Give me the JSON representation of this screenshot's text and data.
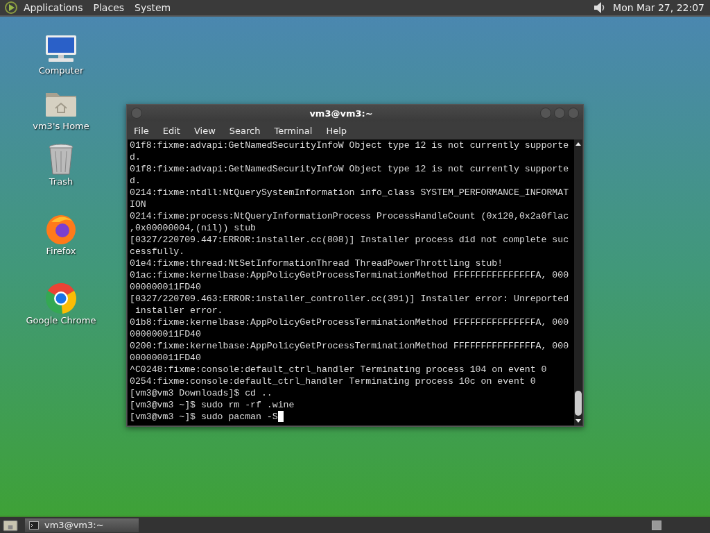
{
  "top_panel": {
    "menus": [
      "Applications",
      "Places",
      "System"
    ],
    "clock": "Mon Mar 27, 22:07"
  },
  "desktop_icons": [
    {
      "kind": "computer",
      "label": "Computer"
    },
    {
      "kind": "home",
      "label": "vm3's Home"
    },
    {
      "kind": "trash",
      "label": "Trash"
    },
    {
      "kind": "firefox",
      "label": "Firefox"
    },
    {
      "kind": "chrome",
      "label": "Google Chrome"
    }
  ],
  "window": {
    "title": "vm3@vm3:~",
    "menu": [
      "File",
      "Edit",
      "View",
      "Search",
      "Terminal",
      "Help"
    ],
    "lines": [
      "01f8:fixme:advapi:GetNamedSecurityInfoW Object type 12 is not currently supporte",
      "d.",
      "01f8:fixme:advapi:GetNamedSecurityInfoW Object type 12 is not currently supporte",
      "d.",
      "0214:fixme:ntdll:NtQuerySystemInformation info_class SYSTEM_PERFORMANCE_INFORMAT",
      "ION",
      "0214:fixme:process:NtQueryInformationProcess ProcessHandleCount (0x120,0x2a0flac",
      ",0x00000004,(nil)) stub",
      "[0327/220709.447:ERROR:installer.cc(808)] Installer process did not complete suc",
      "cessfully.",
      "01e4:fixme:thread:NtSetInformationThread ThreadPowerThrottling stub!",
      "01ac:fixme:kernelbase:AppPolicyGetProcessTerminationMethod FFFFFFFFFFFFFFFA, 000",
      "000000011FD40",
      "[0327/220709.463:ERROR:installer_controller.cc(391)] Installer error: Unreported",
      " installer error.",
      "01b8:fixme:kernelbase:AppPolicyGetProcessTerminationMethod FFFFFFFFFFFFFFFA, 000",
      "000000011FD40",
      "0200:fixme:kernelbase:AppPolicyGetProcessTerminationMethod FFFFFFFFFFFFFFFA, 000",
      "000000011FD40",
      "^C0248:fixme:console:default_ctrl_handler Terminating process 104 on event 0",
      "0254:fixme:console:default_ctrl_handler Terminating process 10c on event 0",
      "[vm3@vm3 Downloads]$ cd ..",
      "[vm3@vm3 ~]$ sudo rm -rf .wine",
      "[vm3@vm3 ~]$ sudo pacman -S"
    ]
  },
  "taskbar": {
    "items": [
      {
        "label": "vm3@vm3:~",
        "selected": true
      }
    ]
  }
}
